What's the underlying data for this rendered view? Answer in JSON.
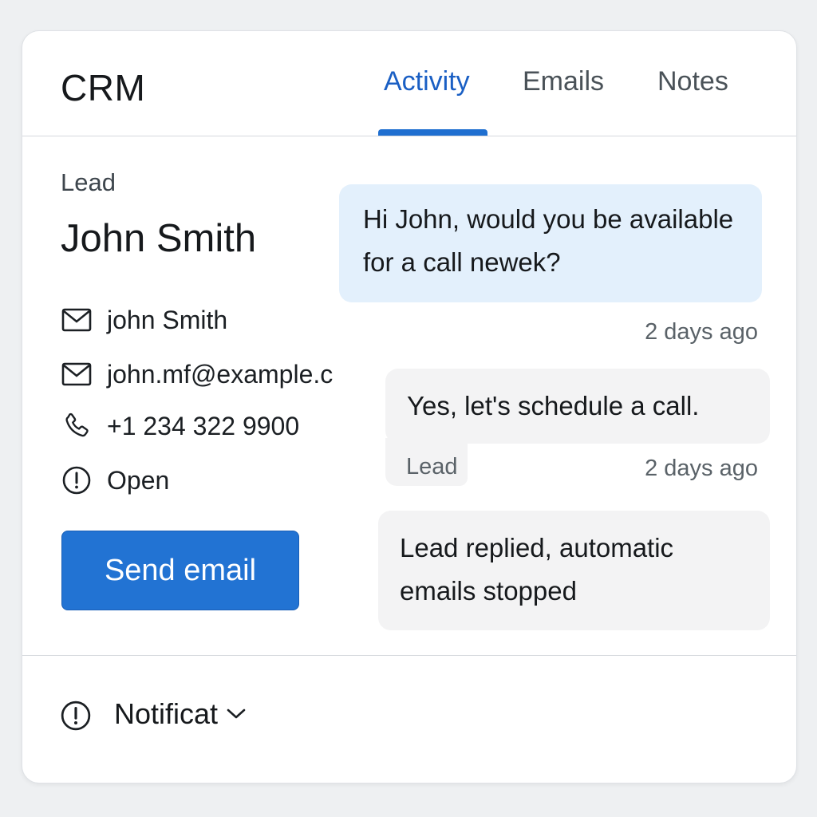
{
  "header": {
    "app_title": "CRM",
    "tabs": [
      {
        "label": "Activity",
        "active": true
      },
      {
        "label": "Emails",
        "active": false
      },
      {
        "label": "Notes",
        "active": false
      }
    ]
  },
  "lead": {
    "section_label": "Lead",
    "name": "John Smith",
    "fields": [
      {
        "icon": "mail-icon",
        "value": "john Smith"
      },
      {
        "icon": "mail-icon",
        "value": "john.mf@example.c"
      },
      {
        "icon": "phone-icon",
        "value": "+1 234 322 9900"
      },
      {
        "icon": "alert-circle-icon",
        "value": "Open"
      }
    ],
    "send_button": "Send email"
  },
  "activity": {
    "messages": [
      {
        "text": "Hi John, would you be available for a call newek?",
        "timestamp": "2 days ago",
        "direction": "outgoing"
      },
      {
        "text": "Yes, let's schedule a call.",
        "sender": "Lead",
        "timestamp": "2 days ago",
        "direction": "incoming"
      },
      {
        "text": "Lead replied, automatic emails stopped",
        "direction": "system"
      }
    ]
  },
  "footer": {
    "notification_label": "Notificat",
    "icon": "alert-circle-icon"
  },
  "colors": {
    "accent": "#1f6fd0",
    "button": "#2273d3",
    "outgoing_bubble": "#e3f0fc",
    "incoming_bubble": "#f3f3f4"
  }
}
